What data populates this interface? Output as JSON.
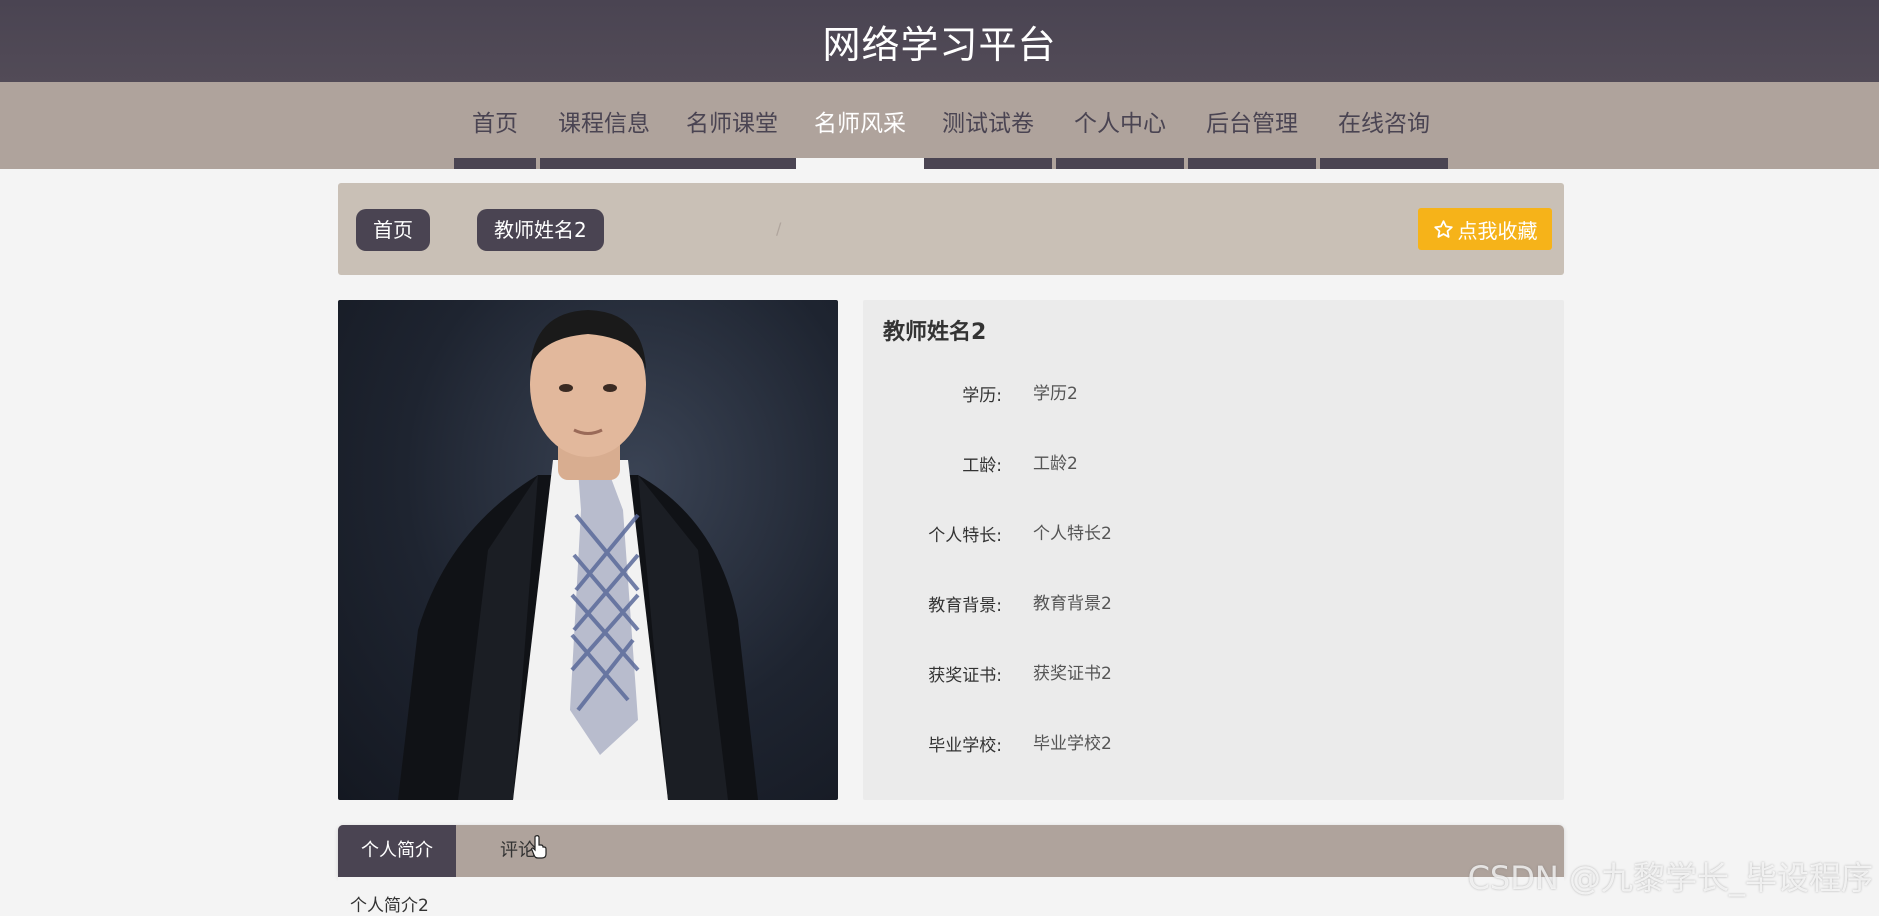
{
  "header": {
    "title": "网络学习平台"
  },
  "nav": {
    "items": [
      {
        "label": "首页"
      },
      {
        "label": "课程信息"
      },
      {
        "label": "名师课堂"
      },
      {
        "label": "名师风采"
      },
      {
        "label": "测试试卷"
      },
      {
        "label": "个人中心"
      },
      {
        "label": "后台管理"
      },
      {
        "label": "在线咨询"
      }
    ],
    "active": "名师风采"
  },
  "breadcrumb": {
    "home": "首页",
    "separator": "/",
    "current": "教师姓名2"
  },
  "favorite": {
    "label": "点我收藏",
    "icon": "star-outline-icon"
  },
  "teacher": {
    "name": "教师姓名2",
    "fields": [
      {
        "label": "学历:",
        "value": "学历2"
      },
      {
        "label": "工龄:",
        "value": "工龄2"
      },
      {
        "label": "个人特长:",
        "value": "个人特长2"
      },
      {
        "label": "教育背景:",
        "value": "教育背景2"
      },
      {
        "label": "获奖证书:",
        "value": "获奖证书2"
      },
      {
        "label": "毕业学校:",
        "value": "毕业学校2"
      }
    ]
  },
  "tabs": {
    "items": [
      {
        "label": "个人简介"
      },
      {
        "label": "评论"
      }
    ],
    "active": "个人简介",
    "content": "个人简介2"
  },
  "watermark": "CSDN @九黎学长_毕设程序",
  "colors": {
    "header_bg": "#4a4452",
    "nav_bg": "#afa39c",
    "breadcrumb_bg": "#c9c0b6",
    "accent": "#f6b319",
    "panel_bg": "#ebebeb"
  }
}
